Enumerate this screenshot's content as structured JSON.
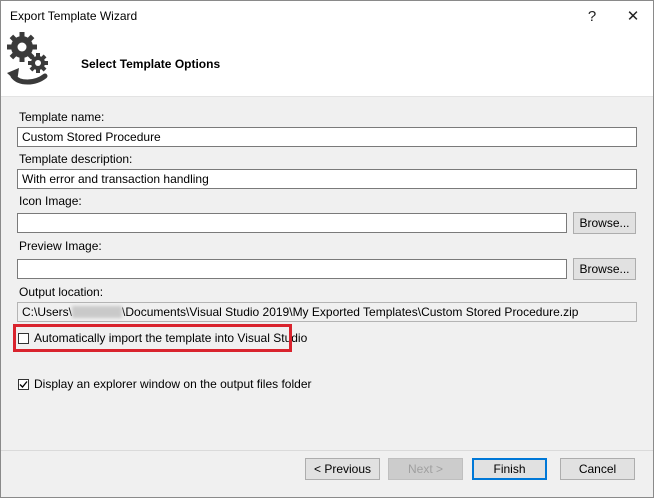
{
  "window": {
    "title": "Export Template Wizard",
    "help_glyph": "?",
    "close_glyph": "✕"
  },
  "header": {
    "title": "Select Template Options",
    "icon": "gears-export-icon"
  },
  "form": {
    "template_name": {
      "label": "Template name:",
      "value": "Custom Stored Procedure"
    },
    "template_description": {
      "label": "Template description:",
      "value": "With error and transaction handling"
    },
    "icon_image": {
      "label": "Icon Image:",
      "value": "",
      "browse_label": "Browse..."
    },
    "preview_image": {
      "label": "Preview Image:",
      "value": "",
      "browse_label": "Browse..."
    },
    "output_location": {
      "label": "Output location:",
      "value_prefix": "C:\\Users\\",
      "value_suffix": "\\Documents\\Visual Studio 2019\\My Exported Templates\\Custom Stored Procedure.zip"
    },
    "auto_import": {
      "label": "Automatically import the template into Visual Studio",
      "checked": false
    },
    "display_explorer": {
      "label": "Display an explorer window on the output files folder",
      "checked": true
    }
  },
  "footer": {
    "previous_label": "< Previous",
    "next_label": "Next >",
    "finish_label": "Finish",
    "cancel_label": "Cancel"
  },
  "colors": {
    "highlight": "#d9232d",
    "accent": "#0078d7",
    "icon_dark": "#3a3a3a"
  }
}
